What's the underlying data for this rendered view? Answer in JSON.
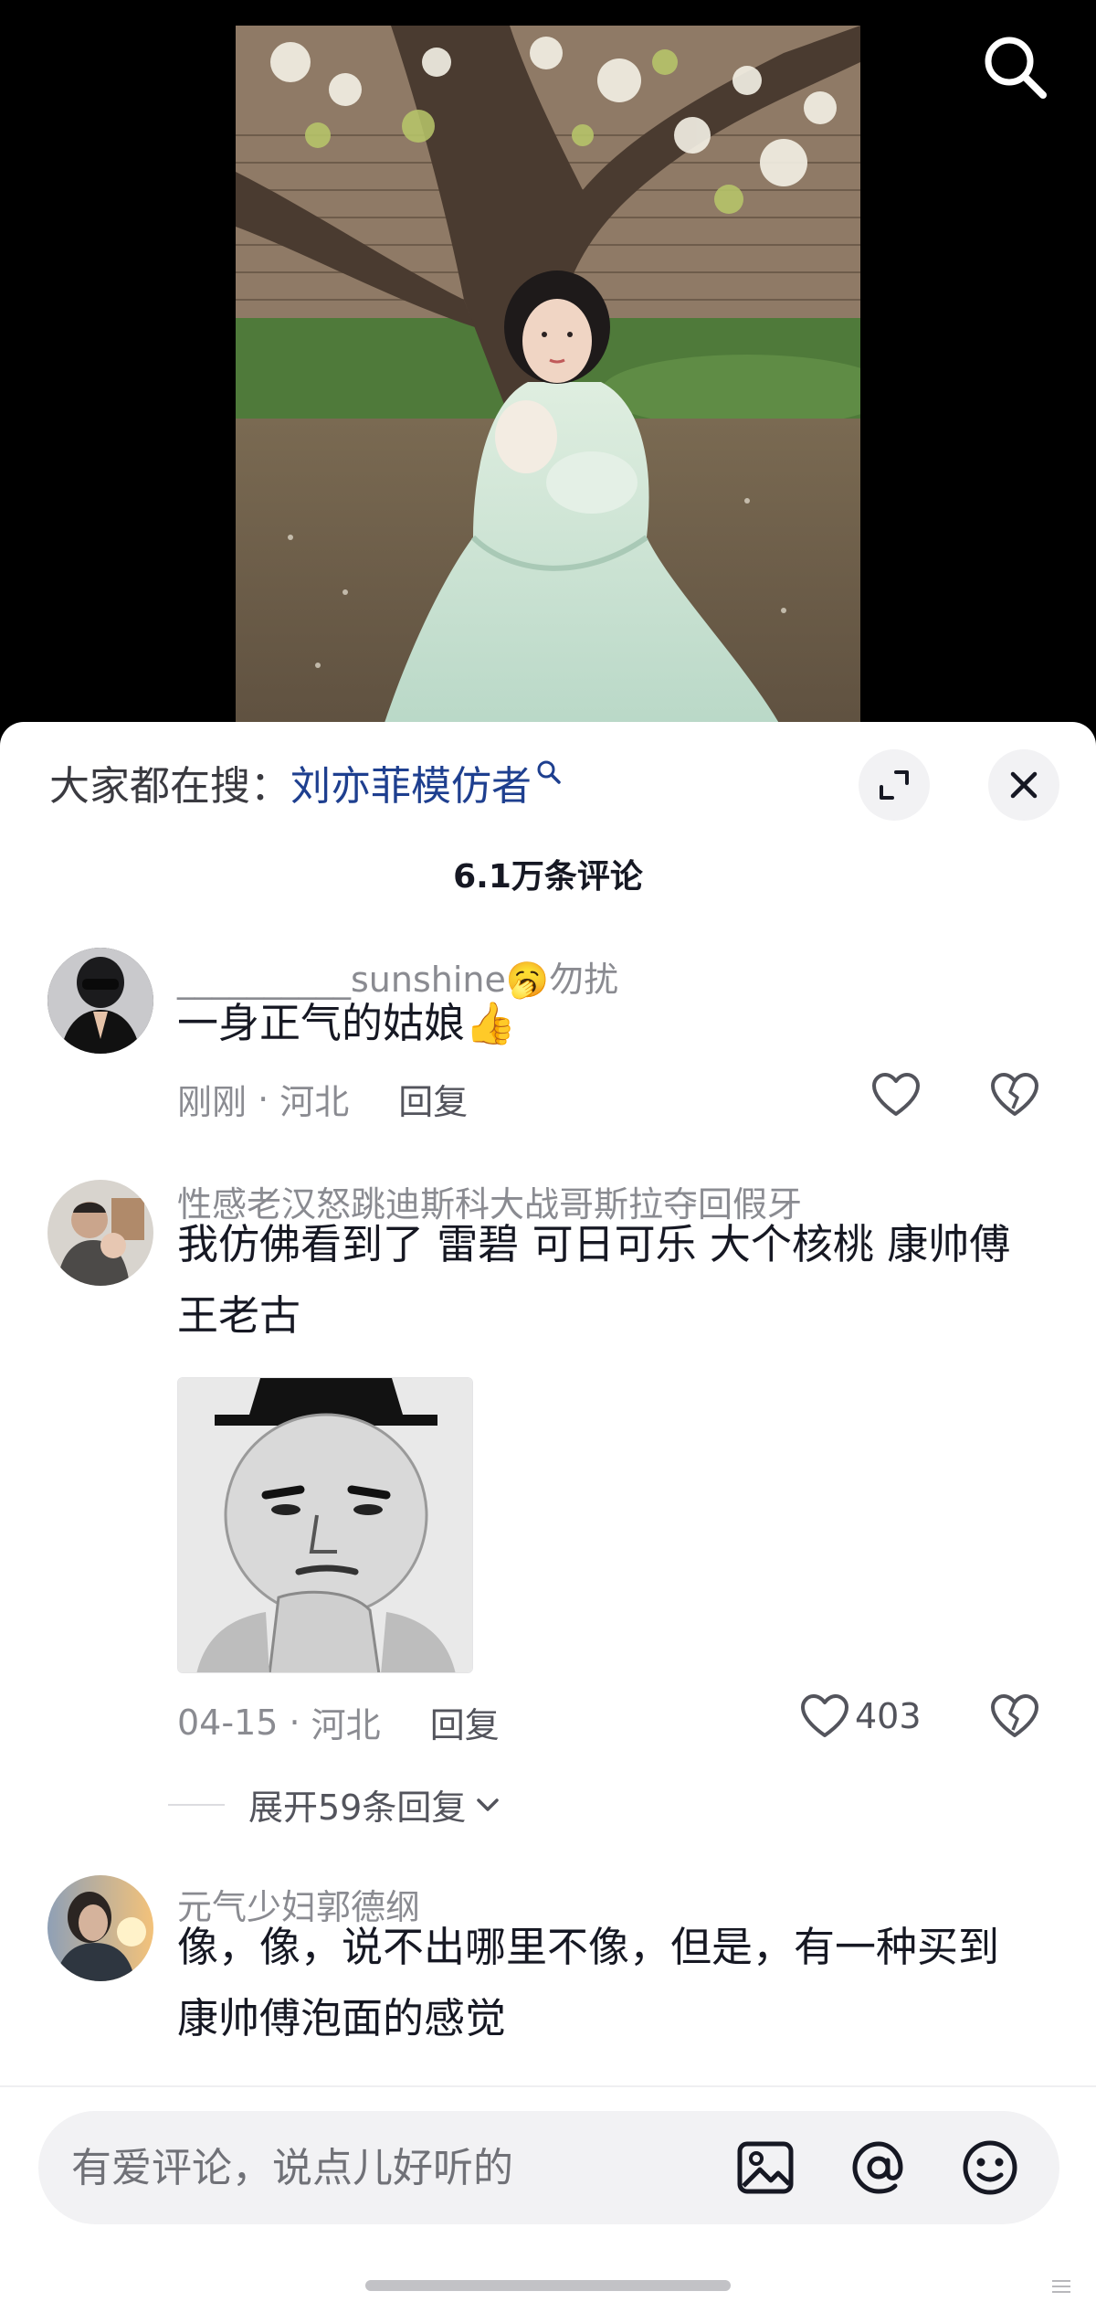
{
  "video": {
    "search_icon": "search-icon"
  },
  "sheet": {
    "trending_prefix": "大家都在搜：",
    "trending_term": "刘亦菲模仿者",
    "comment_count": "6.1万条评论"
  },
  "comments": [
    {
      "username": "__________sunshine🥱勿扰",
      "content": "一身正气的姑娘👍",
      "time": "刚刚",
      "location": "河北",
      "reply_label": "回复",
      "likes": ""
    },
    {
      "username": "性感老汉怒跳迪斯科大战哥斯拉夺回假牙",
      "content": "我仿佛看到了 雷碧 可日可乐 大个核桃 康帅傅 王老古",
      "time": "04-15",
      "location": "河北",
      "reply_label": "回复",
      "likes": "403",
      "expand_replies": "展开59条回复"
    },
    {
      "username": "元气少妇郭德纲",
      "content": "像，像，说不出哪里不像，但是，有一种买到康帅傅泡面的感觉"
    }
  ],
  "input": {
    "placeholder": "有爱评论，说点儿好听的",
    "image_icon": "image-icon",
    "mention_icon": "at-mention-icon",
    "emoji_icon": "emoji-icon"
  },
  "colors": {
    "link_blue": "#1e3f8f",
    "secondary_text": "#8a8b91",
    "like_thumb": "#f5a623"
  }
}
